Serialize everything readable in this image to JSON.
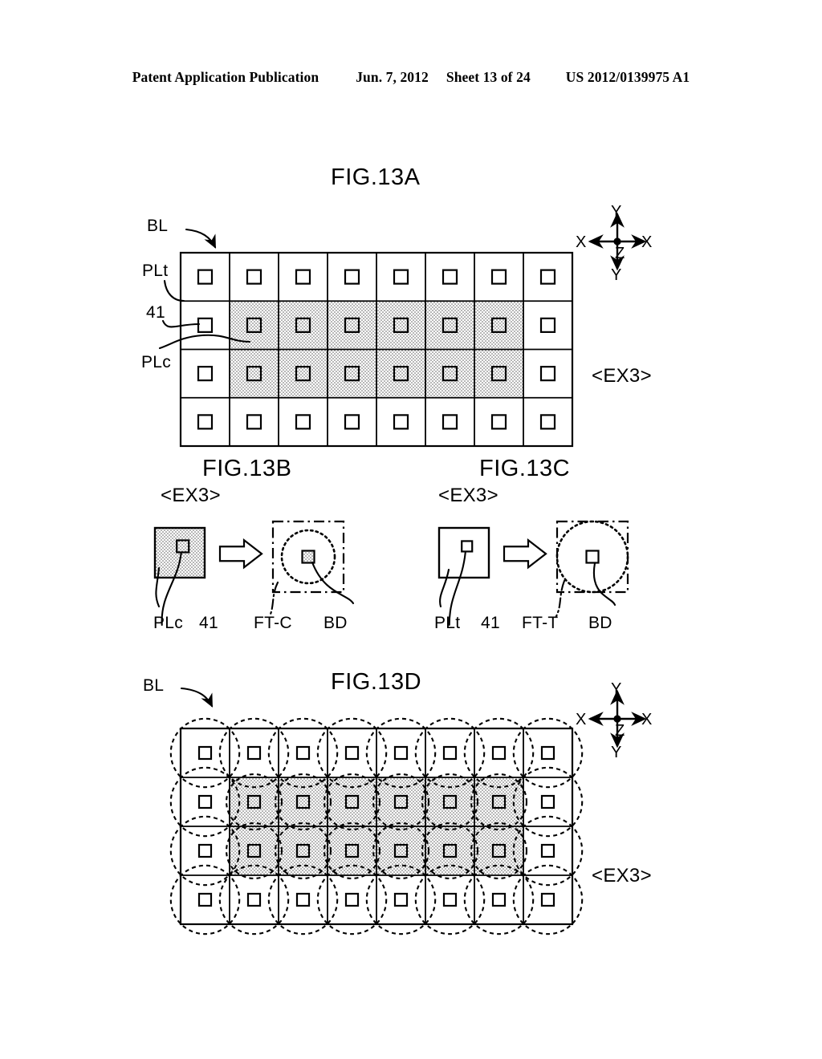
{
  "header": {
    "publication": "Patent Application Publication",
    "date": "Jun. 7, 2012",
    "sheet": "Sheet 13 of 24",
    "patent_number": "US 2012/0139975 A1"
  },
  "figures": {
    "a": {
      "title": "FIG.13A",
      "ex3": "<EX3>",
      "labels": {
        "bl": "BL",
        "plt": "PLt",
        "n41": "41",
        "plc": "PLc"
      },
      "axis": {
        "x_left": "X",
        "x_right": "X",
        "y_top": "Y",
        "y_bottom": "Y",
        "z": "Z"
      },
      "grid": {
        "cols": 8,
        "rows": 4,
        "shaded_cols": [
          2,
          3,
          4,
          5,
          6,
          7
        ],
        "shaded_rows": [
          2,
          3
        ]
      }
    },
    "b": {
      "title": "FIG.13B",
      "ex3": "<EX3>",
      "labels": {
        "plc": "PLc",
        "n41": "41",
        "ftc": "FT-C",
        "bd": "BD"
      }
    },
    "c": {
      "title": "FIG.13C",
      "ex3": "<EX3>",
      "labels": {
        "plt": "PLt",
        "n41": "41",
        "ftt": "FT-T",
        "bd": "BD"
      }
    },
    "d": {
      "title": "FIG.13D",
      "ex3": "<EX3>",
      "labels": {
        "bl": "BL"
      },
      "axis": {
        "x_left": "X",
        "x_right": "X",
        "y_top": "Y",
        "y_bottom": "Y",
        "z": "Z"
      },
      "grid": {
        "cols": 8,
        "rows": 4,
        "shaded_cols": [
          2,
          3,
          4,
          5,
          6,
          7
        ],
        "shaded_rows": [
          2,
          3
        ]
      }
    }
  },
  "colors": {
    "ink": "#000000",
    "paper": "#ffffff",
    "hatch": "#d8d8d8"
  }
}
